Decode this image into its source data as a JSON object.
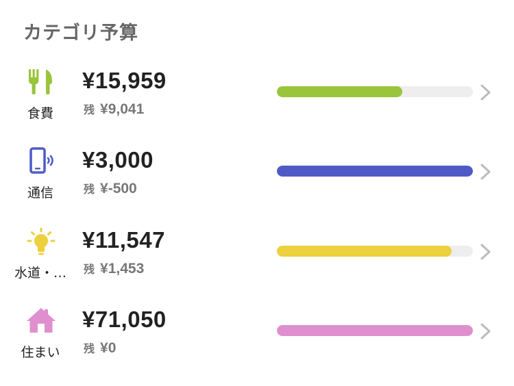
{
  "section": {
    "title": "カテゴリ予算"
  },
  "remaining_label": "残",
  "categories": [
    {
      "label": "食費",
      "icon": "fork-knife-icon",
      "color": "#9ac43c",
      "spent": "¥15,959",
      "remaining": "¥9,041",
      "progress": 0.64
    },
    {
      "label": "通信",
      "icon": "smartphone-icon",
      "color": "#4f5ac7",
      "spent": "¥3,000",
      "remaining": "¥-500",
      "progress": 1.0
    },
    {
      "label": "水道・…",
      "icon": "lightbulb-icon",
      "color": "#ecd03e",
      "spent": "¥11,547",
      "remaining": "¥1,453",
      "progress": 0.89
    },
    {
      "label": "住まい",
      "icon": "house-icon",
      "color": "#df8fcd",
      "spent": "¥71,050",
      "remaining": "¥0",
      "progress": 1.0
    }
  ]
}
